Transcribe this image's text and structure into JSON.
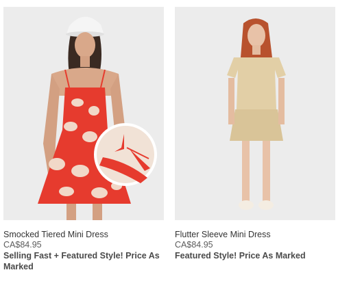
{
  "products": [
    {
      "name": "Smocked Tiered Mini Dress",
      "price": "CA$84.95",
      "badge": "Selling Fast + Featured Style! Price As Marked",
      "image_icon": "red-floral-dress-photo",
      "accent_color": "#e63b2e"
    },
    {
      "name": "Flutter Sleeve Mini Dress",
      "price": "CA$84.95",
      "badge": "Featured Style! Price As Marked",
      "image_icon": "beige-dress-photo",
      "accent_color": "#e2cfa6"
    }
  ]
}
